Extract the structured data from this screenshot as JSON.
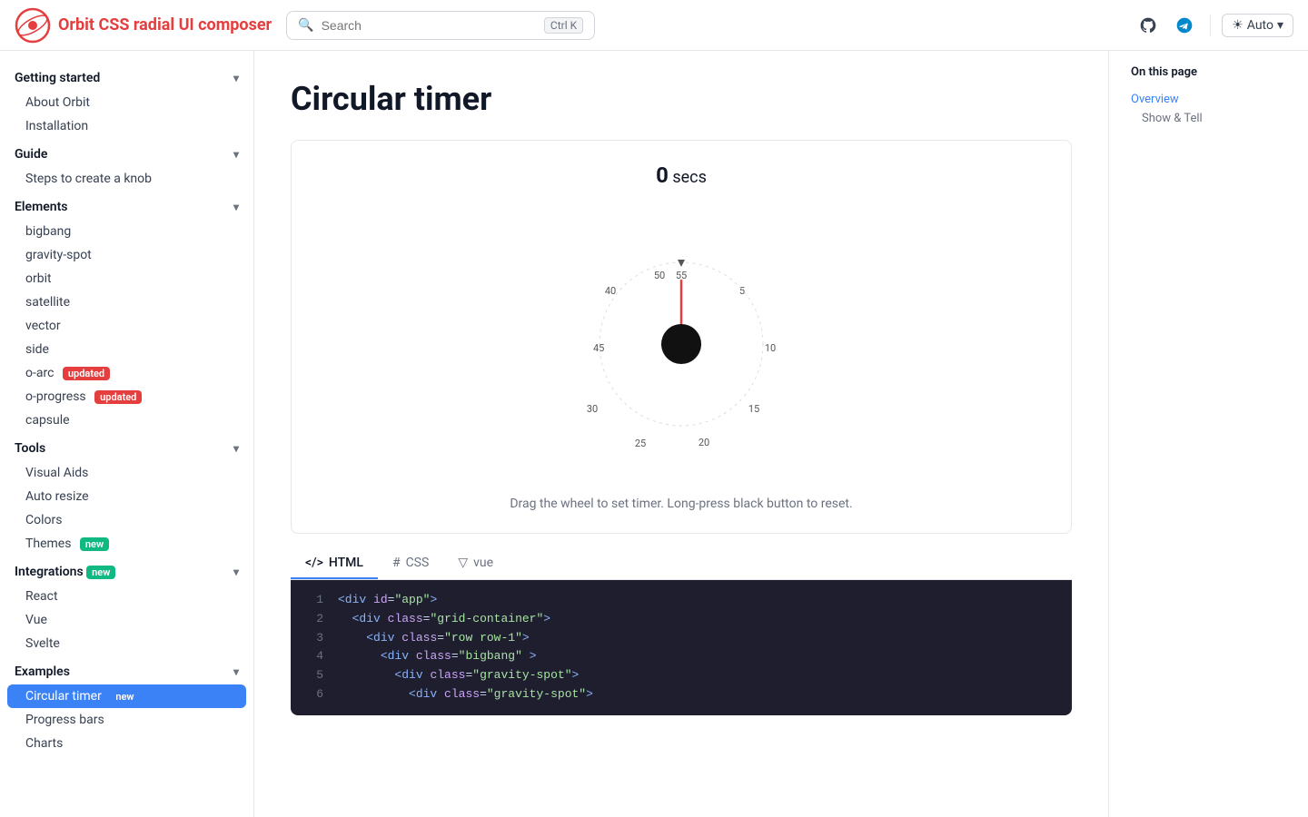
{
  "header": {
    "logo_text": "Orbit CSS radial UI composer",
    "search_placeholder": "Search",
    "kbd_shortcut": "Ctrl K",
    "auto_label": "Auto"
  },
  "sidebar": {
    "sections": [
      {
        "label": "Getting started",
        "items": [
          "About Orbit",
          "Installation"
        ]
      },
      {
        "label": "Guide",
        "items": [
          "Steps to create a knob"
        ]
      },
      {
        "label": "Elements",
        "items": [
          {
            "label": "bigbang",
            "badge": null
          },
          {
            "label": "gravity-spot",
            "badge": null
          },
          {
            "label": "orbit",
            "badge": null
          },
          {
            "label": "satellite",
            "badge": null
          },
          {
            "label": "vector",
            "badge": null
          },
          {
            "label": "side",
            "badge": null
          },
          {
            "label": "o-arc",
            "badge": "updated"
          },
          {
            "label": "o-progress",
            "badge": "updated"
          },
          {
            "label": "capsule",
            "badge": null
          }
        ]
      },
      {
        "label": "Tools",
        "items": [
          {
            "label": "Visual Aids",
            "badge": null
          },
          {
            "label": "Auto resize",
            "badge": null
          },
          {
            "label": "Colors",
            "badge": null
          },
          {
            "label": "Themes",
            "badge": "new"
          }
        ]
      },
      {
        "label": "Integrations",
        "badge": "new",
        "items": [
          "React",
          "Vue",
          "Svelte"
        ]
      },
      {
        "label": "Examples",
        "items": [
          {
            "label": "Circular timer",
            "badge": "new",
            "active": true
          },
          {
            "label": "Progress bars",
            "badge": null
          },
          {
            "label": "Charts",
            "badge": null
          }
        ]
      }
    ]
  },
  "page": {
    "title": "Circular timer",
    "timer_value": "0",
    "timer_unit": "secs",
    "demo_caption": "Drag the wheel to set timer. Long-press black button to reset.",
    "tabs": [
      {
        "label": "HTML",
        "icon": "</>",
        "active": true
      },
      {
        "label": "CSS",
        "icon": "#"
      },
      {
        "label": "vue",
        "icon": "▽"
      }
    ],
    "code_lines": [
      {
        "num": "1",
        "code": "<div id=\"app\">"
      },
      {
        "num": "2",
        "code": "  <div class=\"grid-container\">"
      },
      {
        "num": "3",
        "code": "    <div class=\"row row-1\">"
      },
      {
        "num": "4",
        "code": "      <div class=\"bigbang\" >"
      },
      {
        "num": "5",
        "code": "        <div class=\"gravity-spot\">"
      },
      {
        "num": "6",
        "code": "          <div class=\"gravity-spot\">"
      }
    ]
  },
  "toc": {
    "title": "On this page",
    "items": [
      {
        "label": "Overview",
        "href": true
      },
      {
        "label": "Show & Tell",
        "href": false
      }
    ]
  }
}
